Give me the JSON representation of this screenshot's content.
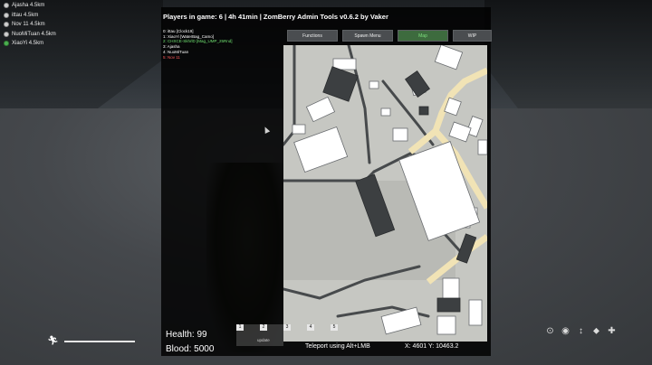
{
  "nearby_players": [
    {
      "label": "Ajasha 4.5km",
      "marker_color": "#cfcfcf"
    },
    {
      "label": "ittau 4.5km",
      "marker_color": "#cfcfcf"
    },
    {
      "label": "Nov 11 4.5km",
      "marker_color": "#cfcfcf"
    },
    {
      "label": "NuoMiTuan 4.5km",
      "marker_color": "#cfcfcf"
    },
    {
      "label": "XiaoYi 4.5km",
      "marker_color": "#4caf50"
    }
  ],
  "admin_panel": {
    "title": "Players in game: 6 | 4h 41min | ZomBerry Admin Tools v0.6.2 by Vaker",
    "players": [
      {
        "text": "0: ittau [Clock19]",
        "color": "#ffffff"
      },
      {
        "text": "1: XiaoYi [WaterBag_Camo]",
        "color": "#ffffff"
      },
      {
        "text": "2: CHXCE-SkhrlD [Mag_UMP_25Rnd]",
        "color": "#6fe06f"
      },
      {
        "text": "3: Ajasha",
        "color": "#ffffff"
      },
      {
        "text": "4: NuoMiTuan",
        "color": "#ffffff"
      },
      {
        "text": "5: Nov 11",
        "color": "#ff5a5a"
      }
    ],
    "tabs": [
      {
        "label": "Functions",
        "active": false
      },
      {
        "label": "Spawn Menu",
        "active": false
      },
      {
        "label": "Map",
        "active": true
      },
      {
        "label": "WIP",
        "active": false
      }
    ],
    "teleport_hint": "Teleport using Alt+LMB",
    "coordinates": "X: 4601  Y: 10463.2"
  },
  "hud": {
    "health_label": "Health: 99",
    "blood_label": "Blood: 5000",
    "quickbar_slots": [
      "1",
      "2",
      "3",
      "4",
      "5"
    ],
    "update_label": "update",
    "stamina_level": 1.0,
    "status_icons": [
      "stomach-icon",
      "hunger-icon",
      "temperature-icon",
      "water-drop-icon",
      "health-cross-icon"
    ]
  },
  "colors": {
    "map_background": "#c9cac5",
    "map_roads": "#f1e3b5",
    "map_buildings": "#ffffff",
    "active_tab": "#3d6b3e"
  }
}
